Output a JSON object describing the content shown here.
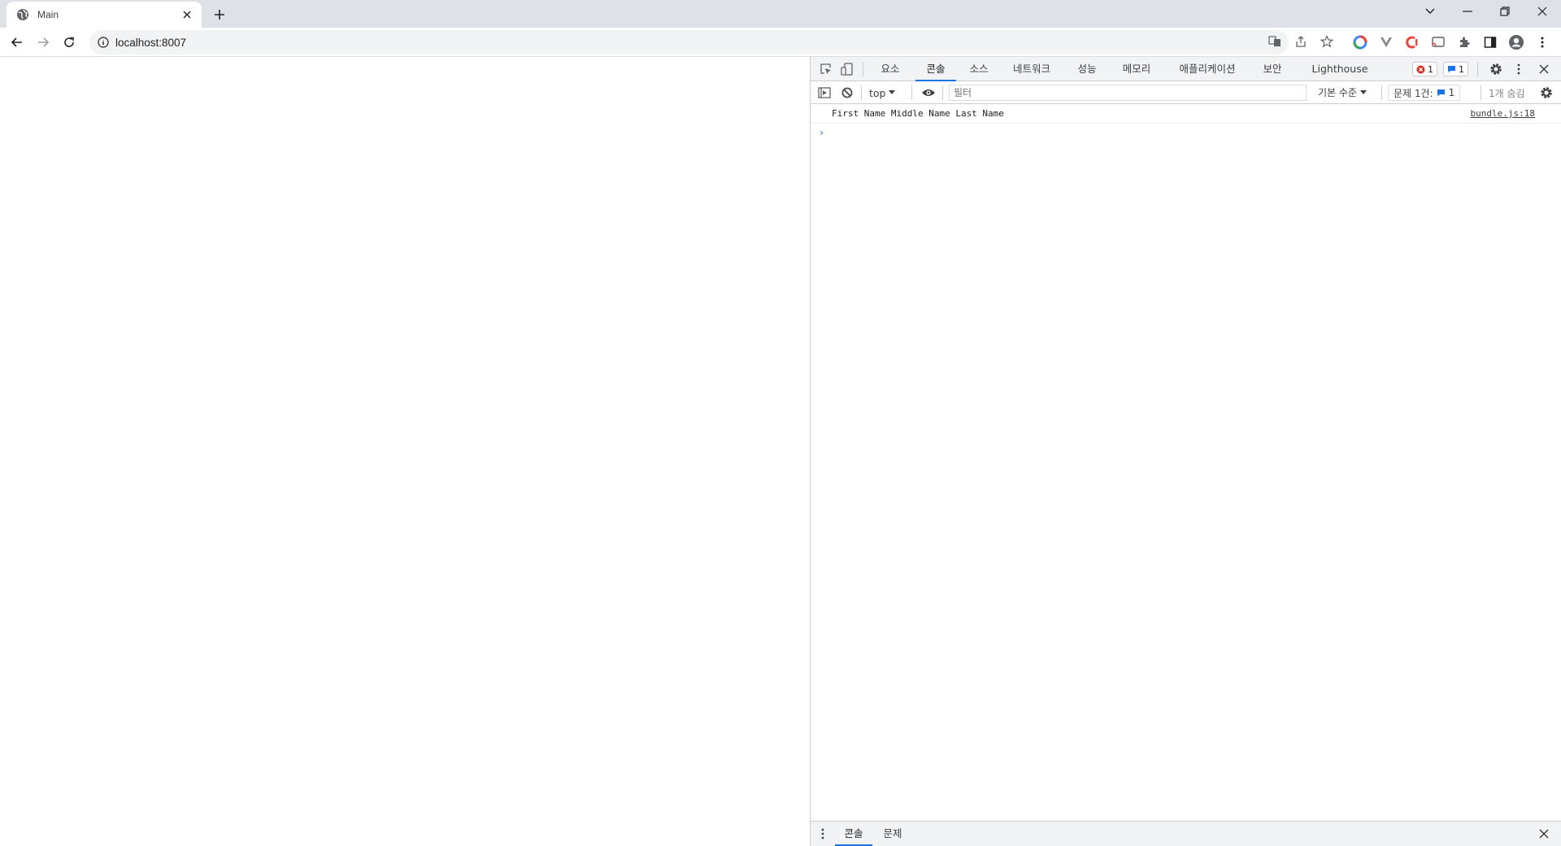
{
  "browser": {
    "tab": {
      "title": "Main",
      "favicon": "globe-icon"
    },
    "address": {
      "url": "localhost:8007"
    }
  },
  "devtools": {
    "tabs": [
      "요소",
      "콘솔",
      "소스",
      "네트워크",
      "성능",
      "메모리",
      "애플리케이션",
      "보안",
      "Lighthouse"
    ],
    "active_tab": "콘솔",
    "error_count": "1",
    "message_count": "1",
    "context": "top",
    "filter_placeholder": "필터",
    "level": "기본 수준",
    "issues": {
      "label": "문제 1건:",
      "count": "1"
    },
    "hidden": "1개 숨김",
    "console_messages": [
      {
        "text": "First Name Middle Name Last Name",
        "source": "bundle.js:18"
      }
    ],
    "prompt": "›",
    "drawer": {
      "tabs": [
        "콘솔",
        "문제"
      ],
      "active": "콘솔"
    }
  },
  "colors": {
    "accent": "#1a73e8",
    "error": "#d93025",
    "tabstrip": "#dee1e6"
  }
}
